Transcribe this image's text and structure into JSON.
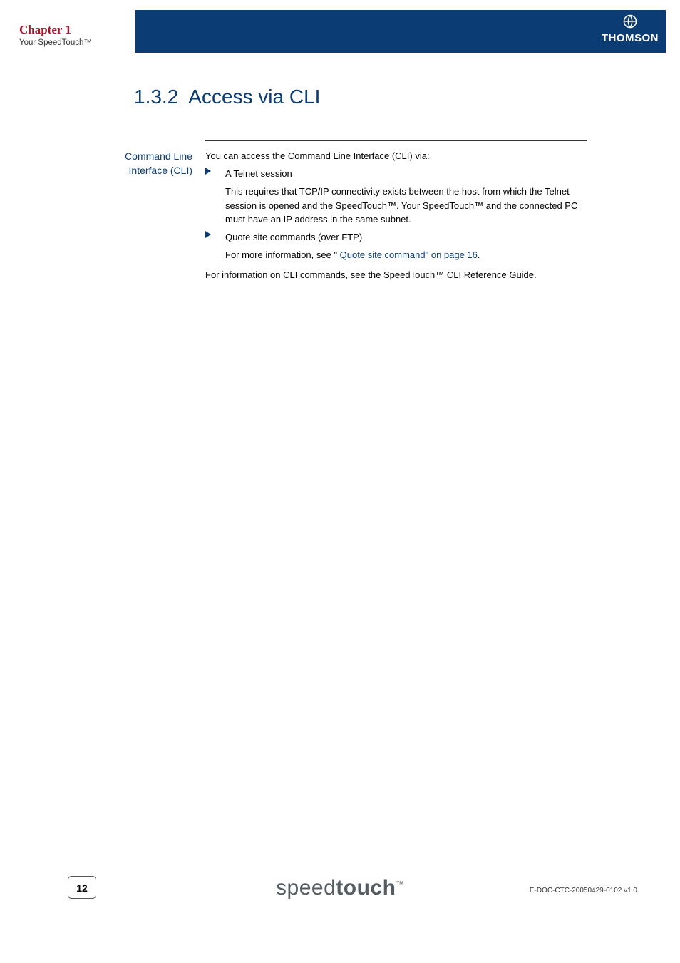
{
  "header": {
    "chapter_label": "Chapter 1",
    "chapter_sub": "Your SpeedTouch™",
    "brand": "THOMSON"
  },
  "section": {
    "number": "1.3.2",
    "title": "Access via CLI"
  },
  "margin_label": "Command Line Interface (CLI)",
  "body": {
    "intro": "You can access the Command Line Interface (CLI) via:",
    "bullets": [
      {
        "head": "A Telnet session",
        "desc": "This requires that TCP/IP connectivity exists between the host from which the Telnet session is opened and the SpeedTouch™. Your SpeedTouch™ and the connected PC must have an IP address in the same subnet."
      },
      {
        "head": "Quote site commands (over FTP)",
        "desc_pre": "For more information, see \"",
        "desc_link": " Quote site command\" on page 16",
        "desc_post": "."
      }
    ],
    "closing": "For information on CLI commands, see the SpeedTouch™ CLI Reference Guide."
  },
  "footer": {
    "page": "12",
    "product_light": "speed",
    "product_bold": "touch",
    "tm": "™",
    "docid": "E-DOC-CTC-20050429-0102 v1.0"
  }
}
